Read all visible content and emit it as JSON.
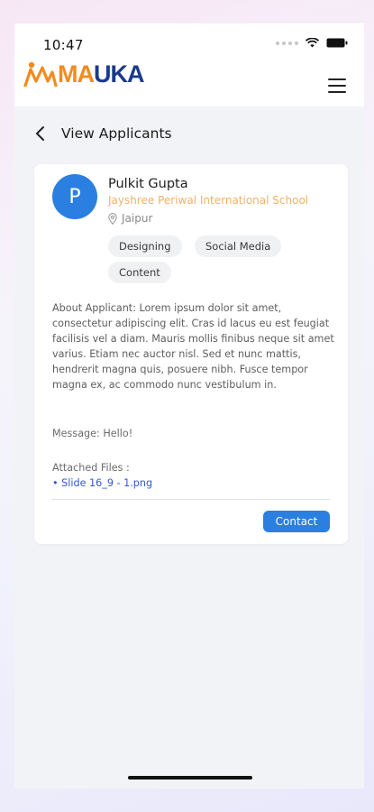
{
  "status_bar": {
    "time": "10:47"
  },
  "app": {
    "logo_part1": "MA",
    "logo_part2": "UKA"
  },
  "header": {
    "title": "View Applicants"
  },
  "applicant": {
    "avatar_letter": "P",
    "name": "Pulkit Gupta",
    "school": "Jayshree Periwal International School",
    "location": "Jaipur",
    "skills": [
      "Designing",
      "Social Media",
      "Content"
    ],
    "about": "About Applicant: Lorem ipsum dolor sit amet, consectetur adipiscing elit. Cras id lacus eu est feugiat facilisis vel a diam. Mauris mollis finibus neque sit amet varius. Etiam nec auctor nisl. Sed et nunc mattis, hendrerit magna quis, posuere nibh. Fusce tempor magna ex, ac commodo nunc vestibulum in.",
    "message": "Message: Hello!",
    "attached_label": "Attached Files :",
    "attached_file": "• Slide 16_9 - 1.png"
  },
  "actions": {
    "contact_label": "Contact"
  },
  "colors": {
    "accent_blue": "#2b7fe0",
    "logo_orange": "#f28b1e",
    "logo_navy": "#1b3a8c",
    "school_orange": "#f3b169",
    "file_link_blue": "#3556d8"
  }
}
